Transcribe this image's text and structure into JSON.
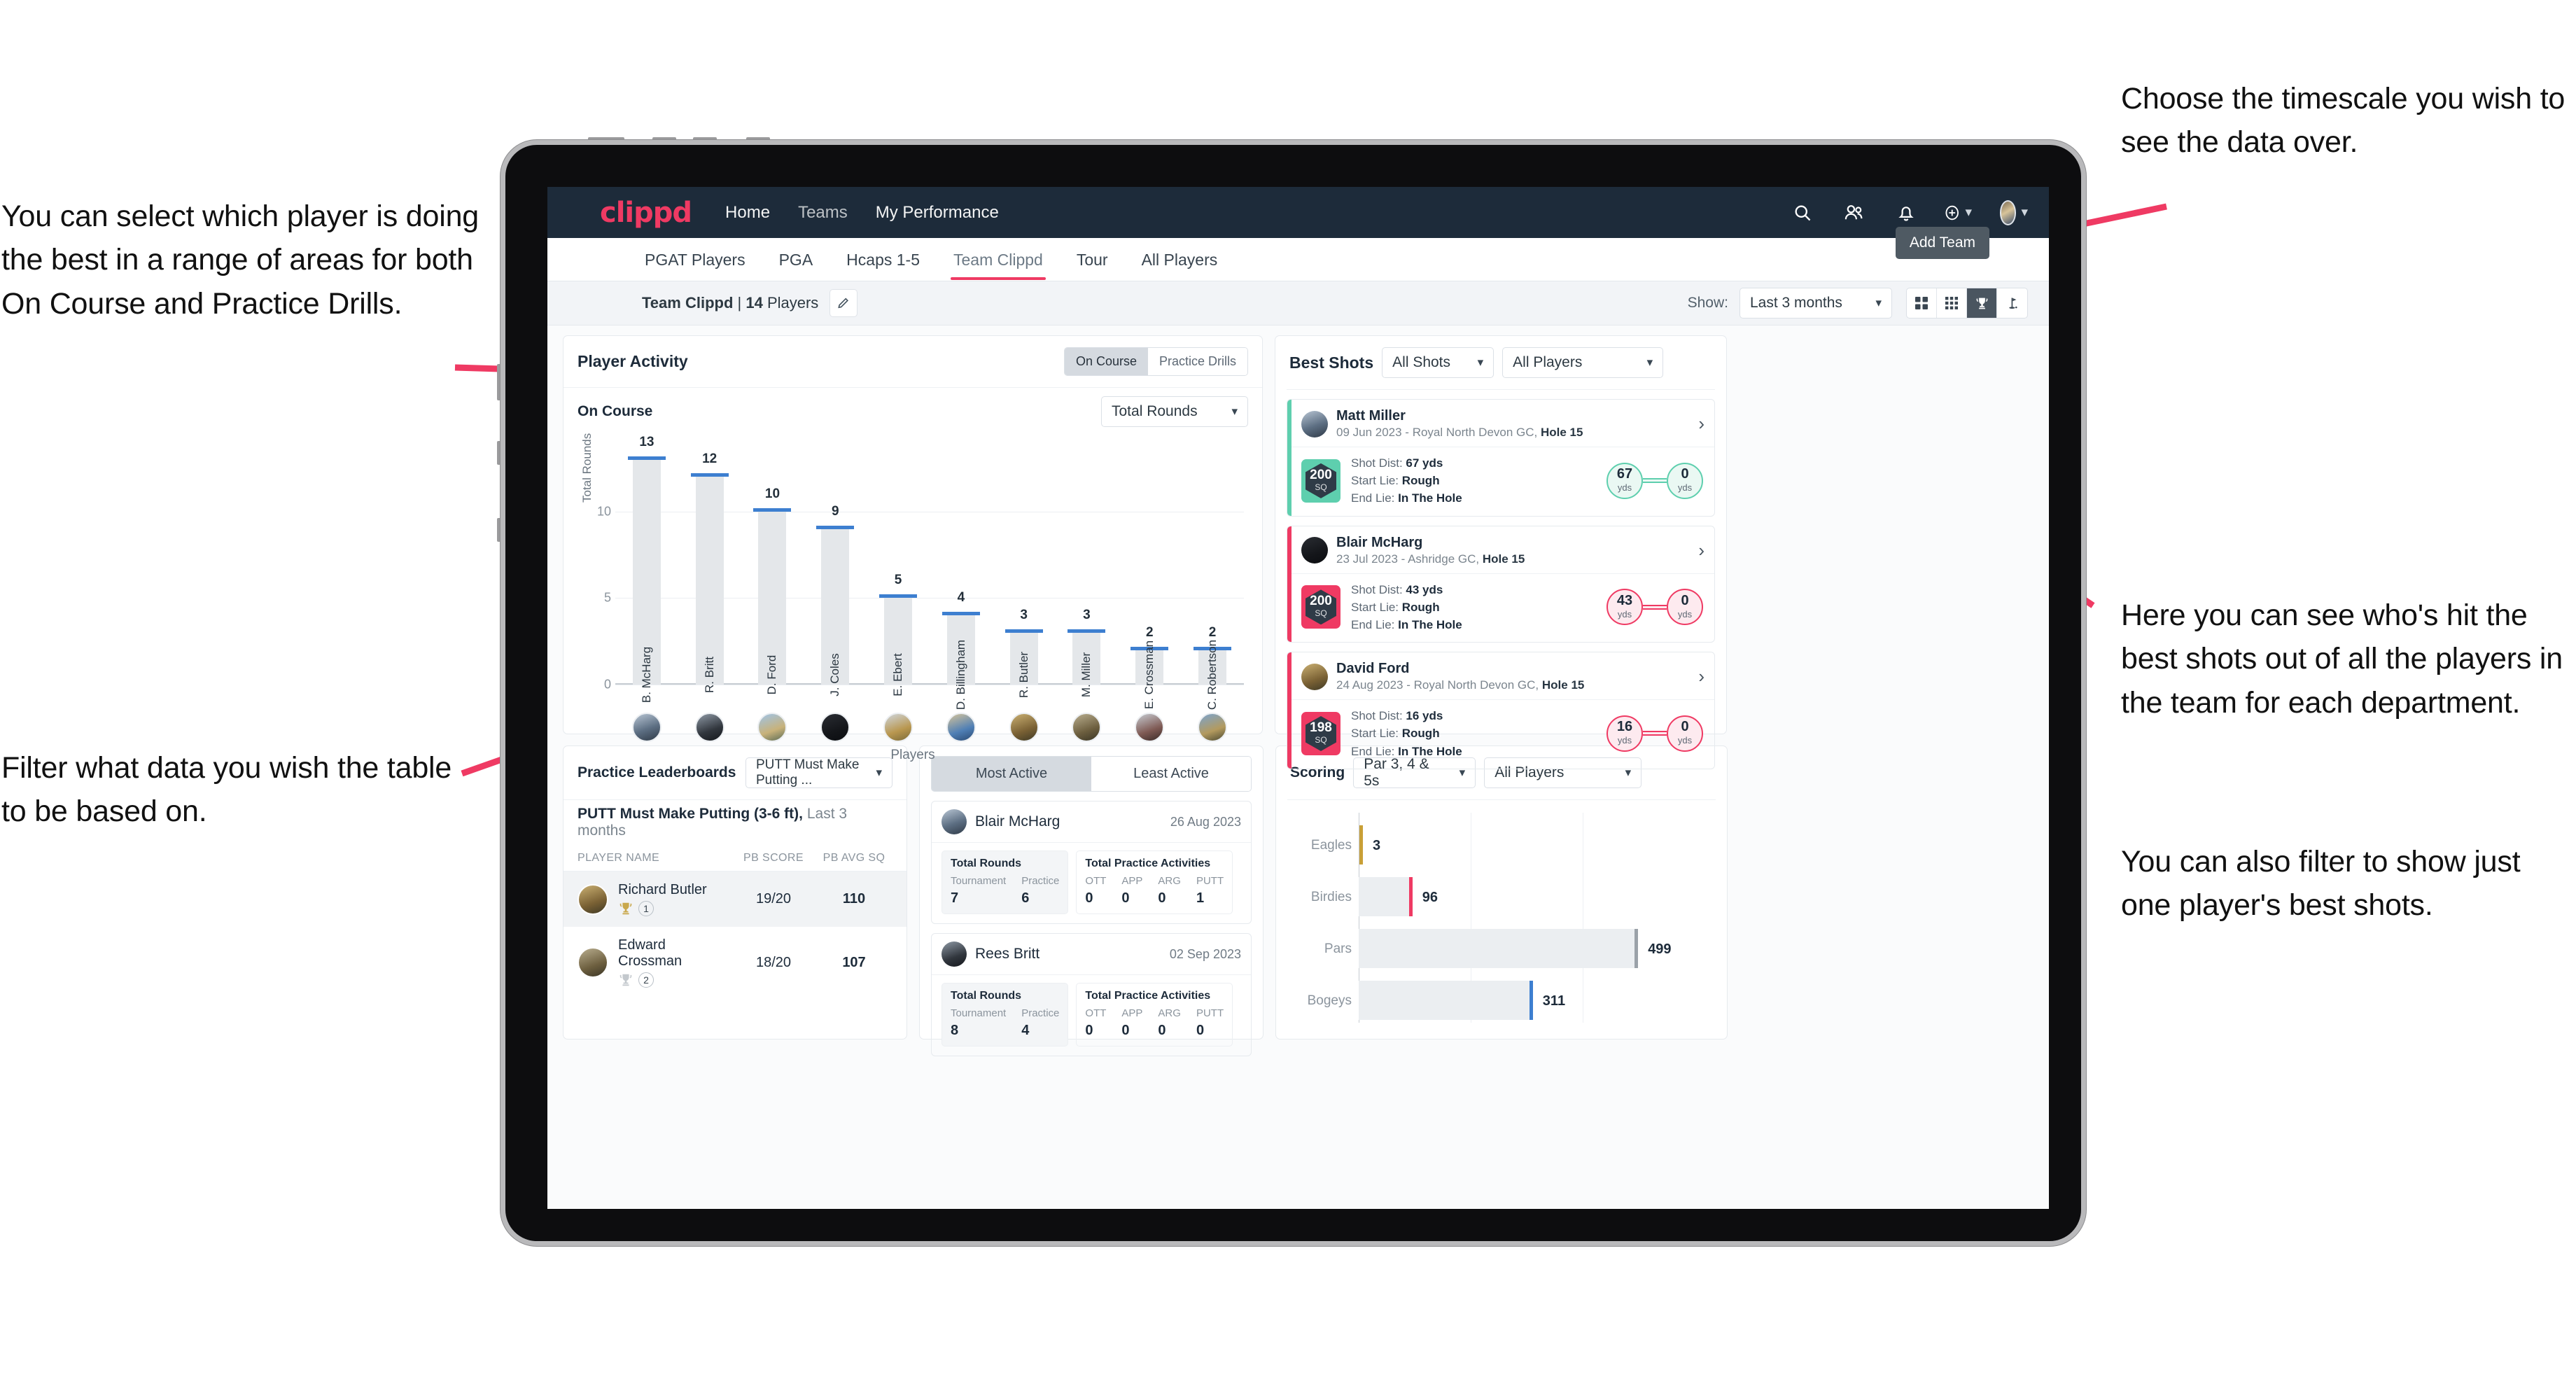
{
  "annotations": {
    "left_top": "You can select which player is doing the best in a range of areas for both On Course and Practice Drills.",
    "left_bottom": "Filter what data you wish the table to be based on.",
    "right_top": "Choose the timescale you wish to see the data over.",
    "right_mid": "Here you can see who's hit the best shots out of all the players in the team for each department.",
    "right_bottom": "You can also filter to show just one player's best shots."
  },
  "topnav": {
    "brand": "clippd",
    "links": [
      {
        "label": "Home",
        "active": true
      },
      {
        "label": "Teams",
        "active": false
      },
      {
        "label": "My Performance",
        "active": true
      }
    ],
    "icons": [
      "search-icon",
      "people-icon",
      "bell-icon",
      "plus-circle-icon",
      "avatar-icon"
    ]
  },
  "tabs": [
    {
      "label": "PGAT Players",
      "active": false
    },
    {
      "label": "PGA",
      "active": false
    },
    {
      "label": "Hcaps 1-5",
      "active": false
    },
    {
      "label": "Team Clippd",
      "active": true
    },
    {
      "label": "Tour",
      "active": false
    },
    {
      "label": "All Players",
      "active": false
    }
  ],
  "tooltip": {
    "add_team": "Add Team"
  },
  "subheader": {
    "team_name": "Team Clippd",
    "separator": " | ",
    "player_count": "14",
    "players_word": " Players",
    "show_label": "Show:",
    "timescale_value": "Last 3 months",
    "view_toggles": [
      "grid-2x2-icon",
      "grid-3x3-icon",
      "trophy-icon",
      "golf-flag-icon"
    ],
    "active_toggle_index": 2
  },
  "player_activity": {
    "title": "Player Activity",
    "segment": [
      {
        "label": "On Course",
        "active": true
      },
      {
        "label": "Practice Drills",
        "active": false
      }
    ],
    "sub_label": "On Course",
    "metric_select": "Total Rounds"
  },
  "chart_data": [
    {
      "type": "bar",
      "title": "Player Activity",
      "xlabel": "Players",
      "ylabel": "Total Rounds",
      "categories": [
        "B. McHarg",
        "R. Britt",
        "D. Ford",
        "J. Coles",
        "E. Ebert",
        "D. Billingham",
        "R. Butler",
        "M. Miller",
        "E. Crossman",
        "C. Robertson"
      ],
      "values": [
        13,
        12,
        10,
        9,
        5,
        4,
        3,
        3,
        2,
        2
      ],
      "ylim": [
        0,
        14
      ],
      "yticks": [
        0,
        5,
        10
      ],
      "grid": true,
      "bar_color": "#e4e7ea",
      "cap_color": "#3d7fd0"
    },
    {
      "type": "bar",
      "orientation": "horizontal",
      "title": "Scoring",
      "categories": [
        "Eagles",
        "Birdies",
        "Pars",
        "Bogeys"
      ],
      "values": [
        3,
        96,
        499,
        311
      ],
      "value_labels": [
        "3",
        "96",
        "499",
        "311"
      ],
      "tip_colors": [
        "#c9a037",
        "#ef3a63",
        "#9ba2a9",
        "#3d7fd0"
      ],
      "xlim": [
        0,
        600
      ],
      "grid": true,
      "legend": "none"
    }
  ],
  "best_shots": {
    "title": "Best Shots",
    "filter_shots": "All Shots",
    "filter_players": "All Players",
    "cards": [
      {
        "name": "Matt Miller",
        "meta_prefix": "09 Jun 2023 - Royal North Devon GC, ",
        "hole": "Hole 15",
        "score": "200",
        "score_unit": "SQ",
        "accent": "#5ecfae",
        "shot_dist_label": "Shot Dist: ",
        "shot_dist": "67 yds",
        "start_lie_label": "Start Lie: ",
        "start_lie": "Rough",
        "end_lie_label": "End Lie: ",
        "end_lie": "In The Hole",
        "from_value": "67",
        "from_unit": "yds",
        "to_value": "0",
        "to_unit": "yds"
      },
      {
        "name": "Blair McHarg",
        "meta_prefix": "23 Jul 2023 - Ashridge GC, ",
        "hole": "Hole 15",
        "score": "200",
        "score_unit": "SQ",
        "accent": "#ef3a63",
        "shot_dist_label": "Shot Dist: ",
        "shot_dist": "43 yds",
        "start_lie_label": "Start Lie: ",
        "start_lie": "Rough",
        "end_lie_label": "End Lie: ",
        "end_lie": "In The Hole",
        "from_value": "43",
        "from_unit": "yds",
        "to_value": "0",
        "to_unit": "yds"
      },
      {
        "name": "David Ford",
        "meta_prefix": "24 Aug 2023 - Royal North Devon GC, ",
        "hole": "Hole 15",
        "score": "198",
        "score_unit": "SQ",
        "accent": "#ef3a63",
        "shot_dist_label": "Shot Dist: ",
        "shot_dist": "16 yds",
        "start_lie_label": "Start Lie: ",
        "start_lie": "Rough",
        "end_lie_label": "End Lie: ",
        "end_lie": "In The Hole",
        "from_value": "16",
        "from_unit": "yds",
        "to_value": "0",
        "to_unit": "yds"
      }
    ]
  },
  "practice_leaderboards": {
    "title": "Practice Leaderboards",
    "drill_select": "PUTT Must Make Putting ...",
    "subtitle_bold": "PUTT Must Make Putting (3-6 ft),",
    "subtitle_light": " Last 3 months",
    "columns": [
      "PLAYER NAME",
      "PB SCORE",
      "PB AVG SQ"
    ],
    "rows": [
      {
        "name": "Richard Butler",
        "rank": "1",
        "pb_score": "19/20",
        "pb_avg_sq": "110",
        "trophy": "gold"
      },
      {
        "name": "Edward Crossman",
        "rank": "2",
        "pb_score": "18/20",
        "pb_avg_sq": "107",
        "trophy": "silver"
      }
    ]
  },
  "activity": {
    "tabs": [
      {
        "label": "Most Active",
        "active": true
      },
      {
        "label": "Least Active",
        "active": false
      }
    ],
    "cards": [
      {
        "name": "Blair McHarg",
        "date": "26 Aug 2023",
        "rounds_title": "Total Rounds",
        "rounds_keys": [
          "Tournament",
          "Practice"
        ],
        "rounds_values": [
          "7",
          "6"
        ],
        "practice_title": "Total Practice Activities",
        "practice_keys": [
          "OTT",
          "APP",
          "ARG",
          "PUTT"
        ],
        "practice_values": [
          "0",
          "0",
          "0",
          "1"
        ]
      },
      {
        "name": "Rees Britt",
        "date": "02 Sep 2023",
        "rounds_title": "Total Rounds",
        "rounds_keys": [
          "Tournament",
          "Practice"
        ],
        "rounds_values": [
          "8",
          "4"
        ],
        "practice_title": "Total Practice Activities",
        "practice_keys": [
          "OTT",
          "APP",
          "ARG",
          "PUTT"
        ],
        "practice_values": [
          "0",
          "0",
          "0",
          "0"
        ]
      }
    ]
  },
  "scoring": {
    "title": "Scoring",
    "filter_par": "Par 3, 4 & 5s",
    "filter_players": "All Players"
  },
  "colors": {
    "brand_pink": "#ef3a63",
    "nav_dark": "#1d2b3a",
    "accent_blue": "#3d7fd0",
    "accent_teal": "#5ecfae"
  }
}
